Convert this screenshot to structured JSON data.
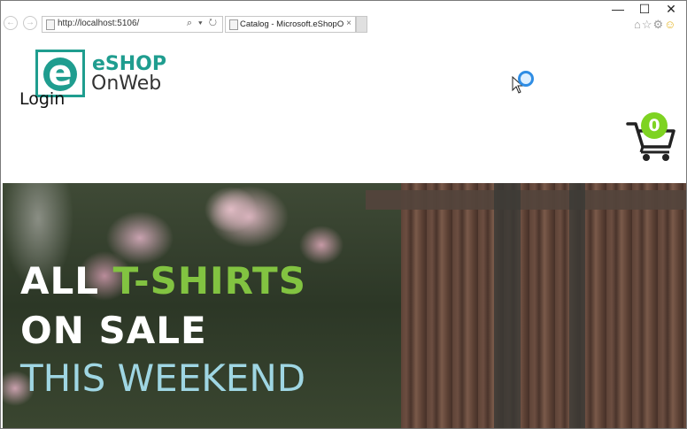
{
  "browser": {
    "url": "http://localhost:5106/",
    "tab_title": "Catalog - Microsoft.eShopO...",
    "tab_close": "×",
    "back": "←",
    "forward": "→",
    "address_icons": "⌕ ▾ ↻",
    "window_buttons": {
      "minimize": "—",
      "maximize": "☐",
      "close": "✕"
    },
    "toolbar_icons": {
      "home": "⌂",
      "favorites": "☆",
      "settings": "⚙",
      "smiley": "☺"
    }
  },
  "header": {
    "logo_letter": "e",
    "logo_line1": "eSHOP",
    "logo_line2": "OnWeb",
    "login_label": "Login",
    "cart_count": "0"
  },
  "hero": {
    "line1_prefix": "ALL ",
    "line1_accent": "T-SHIRTS",
    "line2": "ON SALE",
    "line3": "THIS WEEKEND"
  },
  "colors": {
    "brand_teal": "#1f9d8f",
    "badge_green": "#7ed321",
    "accent_green": "#82c341",
    "headline_blue": "#9fd6e3"
  }
}
